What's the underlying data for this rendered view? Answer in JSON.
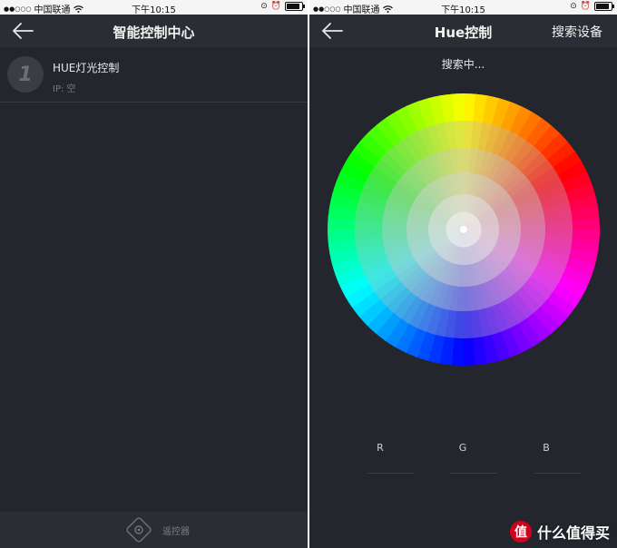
{
  "status_bar": {
    "carrier": "中国联通",
    "time": "下午10:15",
    "signal_icon": "signal-dots-icon",
    "wifi_icon": "wifi-icon",
    "battery_level": 0.85
  },
  "left_screen": {
    "title": "智能控制中心",
    "devices": [
      {
        "number": "1",
        "name": "HUE灯光控制",
        "ip": "IP: 空"
      }
    ],
    "bottom_bar": {
      "remote_label": "遥控器",
      "remote_icon": "gamepad-icon"
    }
  },
  "right_screen": {
    "title": "Hue控制",
    "action": "搜索设备",
    "status_text": "搜索中...",
    "color_wheel_icon": "color-wheel",
    "channels": [
      "R",
      "G",
      "B"
    ]
  },
  "watermark": {
    "text": "什么值得买",
    "logo": "值"
  },
  "colors": {
    "background": "#23262c",
    "navbar": "#2a2d33",
    "status_bar": "#f5f5f5",
    "watermark_red": "#d0021b"
  }
}
